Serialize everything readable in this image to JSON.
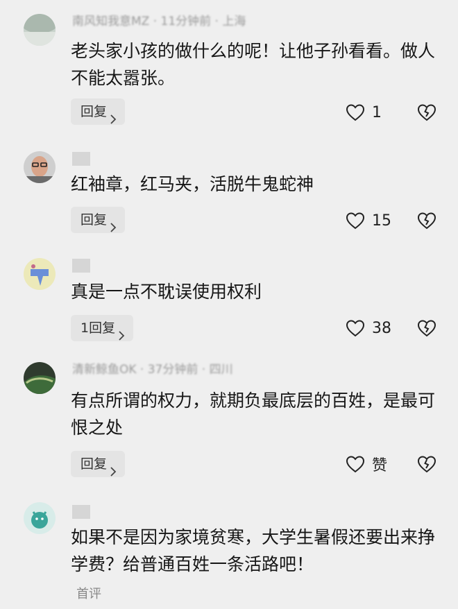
{
  "comments": [
    {
      "meta": "南风知我意MZ · 11分钟前 · 上海",
      "text": "老头家小孩的做什么的呢！让他子孙看看。做人不能太嚣张。",
      "reply": "回复",
      "likes": "1"
    },
    {
      "meta": "",
      "text": "红袖章，红马夹，活脱牛鬼蛇神",
      "reply": "回复",
      "likes": "15"
    },
    {
      "meta": "",
      "text": "真是一点不耽误使用权利",
      "reply": "1回复",
      "likes": "38"
    },
    {
      "meta": "清新鲸鱼OK · 37分钟前 · 四川",
      "text": "有点所谓的权力，就期负最底层的百姓，是最可恨之处",
      "reply": "回复",
      "likes": "赞"
    },
    {
      "meta": "",
      "text": "如果不是因为家境贫寒，大学生暑假还要出来挣学费？给普通百姓一条活路吧！",
      "first_review": "首评"
    }
  ],
  "icons": {
    "like": "heart-outline-icon",
    "dislike": "broken-heart-icon",
    "chevron": "chevron-right-icon"
  },
  "colors": {
    "background": "#efefef",
    "reply_button_bg": "#e4e4e4",
    "text": "#161616",
    "meta": "#9a9a9a"
  }
}
